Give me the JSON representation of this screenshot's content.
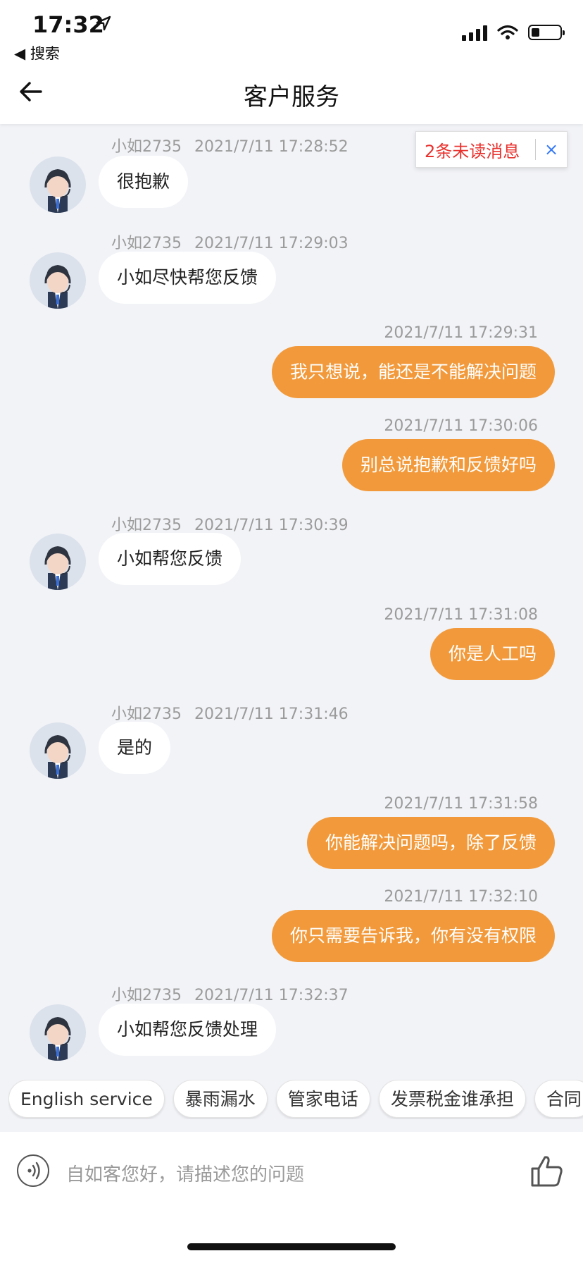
{
  "status_bar": {
    "time": "17:32",
    "back_app": "◀ 搜索"
  },
  "nav": {
    "title": "客户服务"
  },
  "unread": {
    "text": "2条未读消息",
    "close": "×"
  },
  "messages": [
    {
      "side": "in",
      "sender": "小如2735",
      "time": "2021/7/11 17:28:52",
      "text": "很抱歉"
    },
    {
      "side": "in",
      "sender": "小如2735",
      "time": "2021/7/11 17:29:03",
      "text": "小如尽快帮您反馈"
    },
    {
      "side": "out",
      "sender": "",
      "time": "2021/7/11 17:29:31",
      "text": "我只想说，能还是不能解决问题"
    },
    {
      "side": "out",
      "sender": "",
      "time": "2021/7/11 17:30:06",
      "text": "别总说抱歉和反馈好吗"
    },
    {
      "side": "in",
      "sender": "小如2735",
      "time": "2021/7/11 17:30:39",
      "text": "小如帮您反馈"
    },
    {
      "side": "out",
      "sender": "",
      "time": "2021/7/11 17:31:08",
      "text": "你是人工吗"
    },
    {
      "side": "in",
      "sender": "小如2735",
      "time": "2021/7/11 17:31:46",
      "text": "是的"
    },
    {
      "side": "out",
      "sender": "",
      "time": "2021/7/11 17:31:58",
      "text": "你能解决问题吗，除了反馈"
    },
    {
      "side": "out",
      "sender": "",
      "time": "2021/7/11 17:32:10",
      "text": "你只需要告诉我，你有没有权限"
    },
    {
      "side": "in",
      "sender": "小如2735",
      "time": "2021/7/11 17:32:37",
      "text": "小如帮您反馈处理"
    }
  ],
  "quick_replies": [
    "English service",
    "暴雨漏水",
    "管家电话",
    "发票税金谁承担",
    "合同"
  ],
  "input": {
    "placeholder": "自如客您好，请描述您的问题"
  },
  "colors": {
    "outgoing_bubble": "#f29a3b",
    "incoming_bubble": "#ffffff",
    "background": "#f2f3f7",
    "unread_text": "#e8322e"
  },
  "icons": [
    "location-arrow-icon",
    "signal-icon",
    "wifi-icon",
    "battery-icon",
    "back-arrow-icon",
    "close-icon",
    "headset-agent-avatar",
    "voice-icon",
    "thumbs-up-icon"
  ]
}
